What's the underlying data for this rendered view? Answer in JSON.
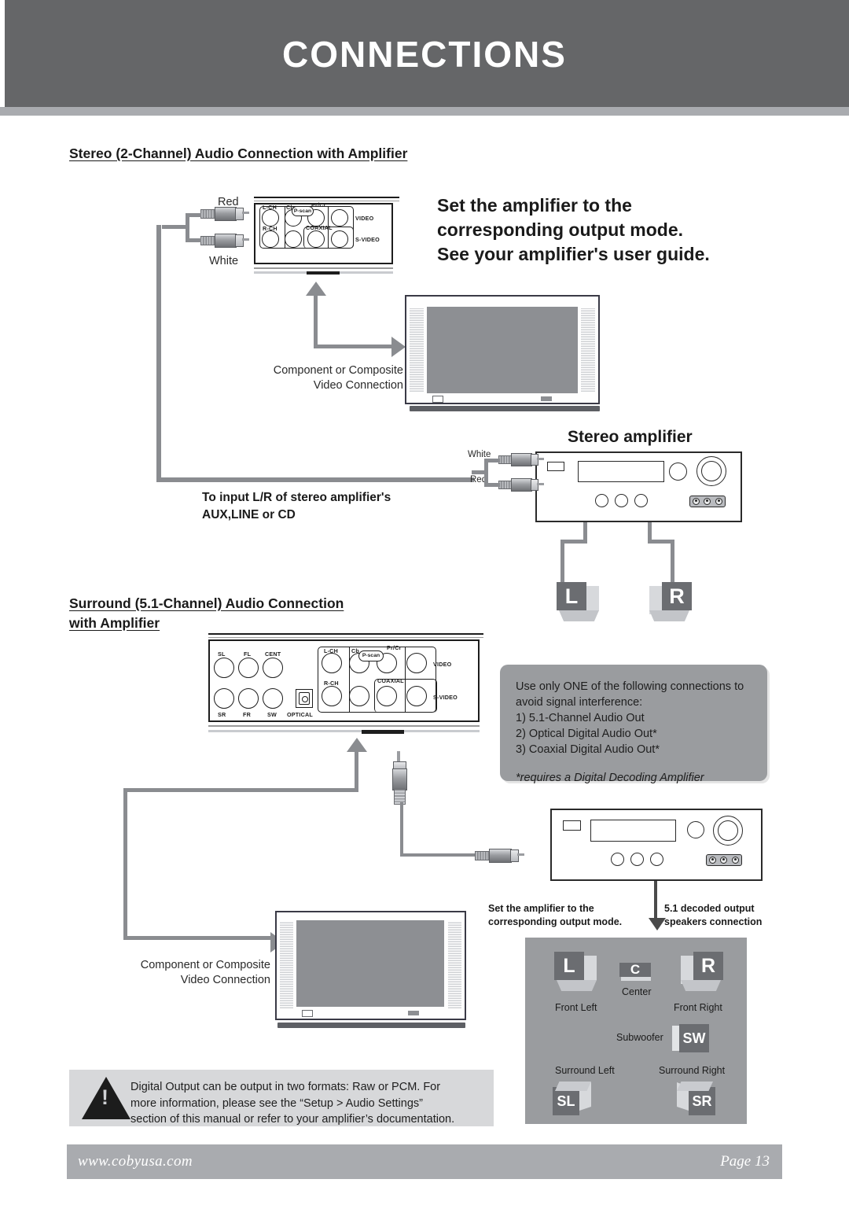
{
  "header": {
    "title": "CONNECTIONS"
  },
  "sections": {
    "stereo": {
      "heading": "Stereo (2-Channel) Audio Connection with Amplifier",
      "plug_red": "Red",
      "plug_white": "White",
      "amplifier_note": "Set the amplifier to the\ncorresponding output mode.\nSee your amplifier's user guide.",
      "amplifier_note_lines": [
        "Set the amplifier to the",
        "corresponding output mode.",
        "See your amplifier's user guide."
      ],
      "video_connection_label_lines": [
        "Component or Composite",
        "Video Connection"
      ],
      "amp_title": "Stereo amplifier",
      "amp_plug_white": "White",
      "amp_plug_red": "Red",
      "input_note_lines": [
        "To input L/R of stereo amplifier's",
        "AUX,LINE or CD"
      ],
      "speaker_left": "L",
      "speaker_right": "R"
    },
    "surround": {
      "heading_lines": [
        "Surround (5.1-Channel) Audio Connection ",
        "with Amplifier"
      ],
      "info_lines": [
        "Use only ONE of the following connections to",
        "avoid signal interference:",
        "1) 5.1-Channel Audio Out",
        "2) Optical Digital Audio Out*",
        "3) Coaxial Digital Audio Out*"
      ],
      "info_footnote": "*requires a Digital Decoding Amplifier",
      "video_connection_label_lines": [
        "Component or Composite",
        "Video Connection"
      ],
      "amp_note_lines": [
        "Set the amplifier to the",
        "corresponding output mode."
      ],
      "speakers_note_lines": [
        "5.1 decoded output",
        "speakers connection"
      ],
      "speaker_layout": [
        {
          "id": "front-left",
          "badge": "L",
          "label": "Front Left"
        },
        {
          "id": "center",
          "badge": "C",
          "label": "Center"
        },
        {
          "id": "front-right",
          "badge": "R",
          "label": "Front Right"
        },
        {
          "id": "subwoofer",
          "badge": "SW",
          "label": "Subwoofer"
        },
        {
          "id": "surround-left",
          "badge": "SL",
          "label": "Surround Left"
        },
        {
          "id": "surround-right",
          "badge": "SR",
          "label": "Surround Right"
        }
      ]
    }
  },
  "rear_panel_top": {
    "jack_labels": [
      "L-CH",
      "R-CH",
      "Cb",
      "Pr/Cr",
      "COAXIAL",
      "VIDEO",
      "S-VIDEO"
    ],
    "pscan": "P-scan"
  },
  "rear_panel_bottom": {
    "jack_labels": [
      "SL",
      "FL",
      "CENT",
      "SR",
      "FR",
      "SW",
      "OPTICAL",
      "L-CH",
      "R-CH",
      "Cb",
      "Pr/Cr",
      "COAXIAL",
      "VIDEO",
      "S-VIDEO"
    ],
    "pscan": "P-scan"
  },
  "notice": {
    "lines": [
      "Digital Output can be output in two formats: Raw or PCM. For",
      "more information, please see the “Setup > Audio Settings”",
      "section of this manual or refer to your amplifier’s documentation."
    ],
    "icon": "warning-triangle"
  },
  "footer": {
    "website": "www.cobyusa.com",
    "page": "Page 13"
  },
  "colors": {
    "header_band": "#656668",
    "header_rule": "#a9abaf",
    "info_box": "#9a9c9f",
    "notice_box": "#d7d8da",
    "wire": "#8a8c90",
    "speaker_face": "#6b6d71",
    "footer": "#a9abaf"
  }
}
